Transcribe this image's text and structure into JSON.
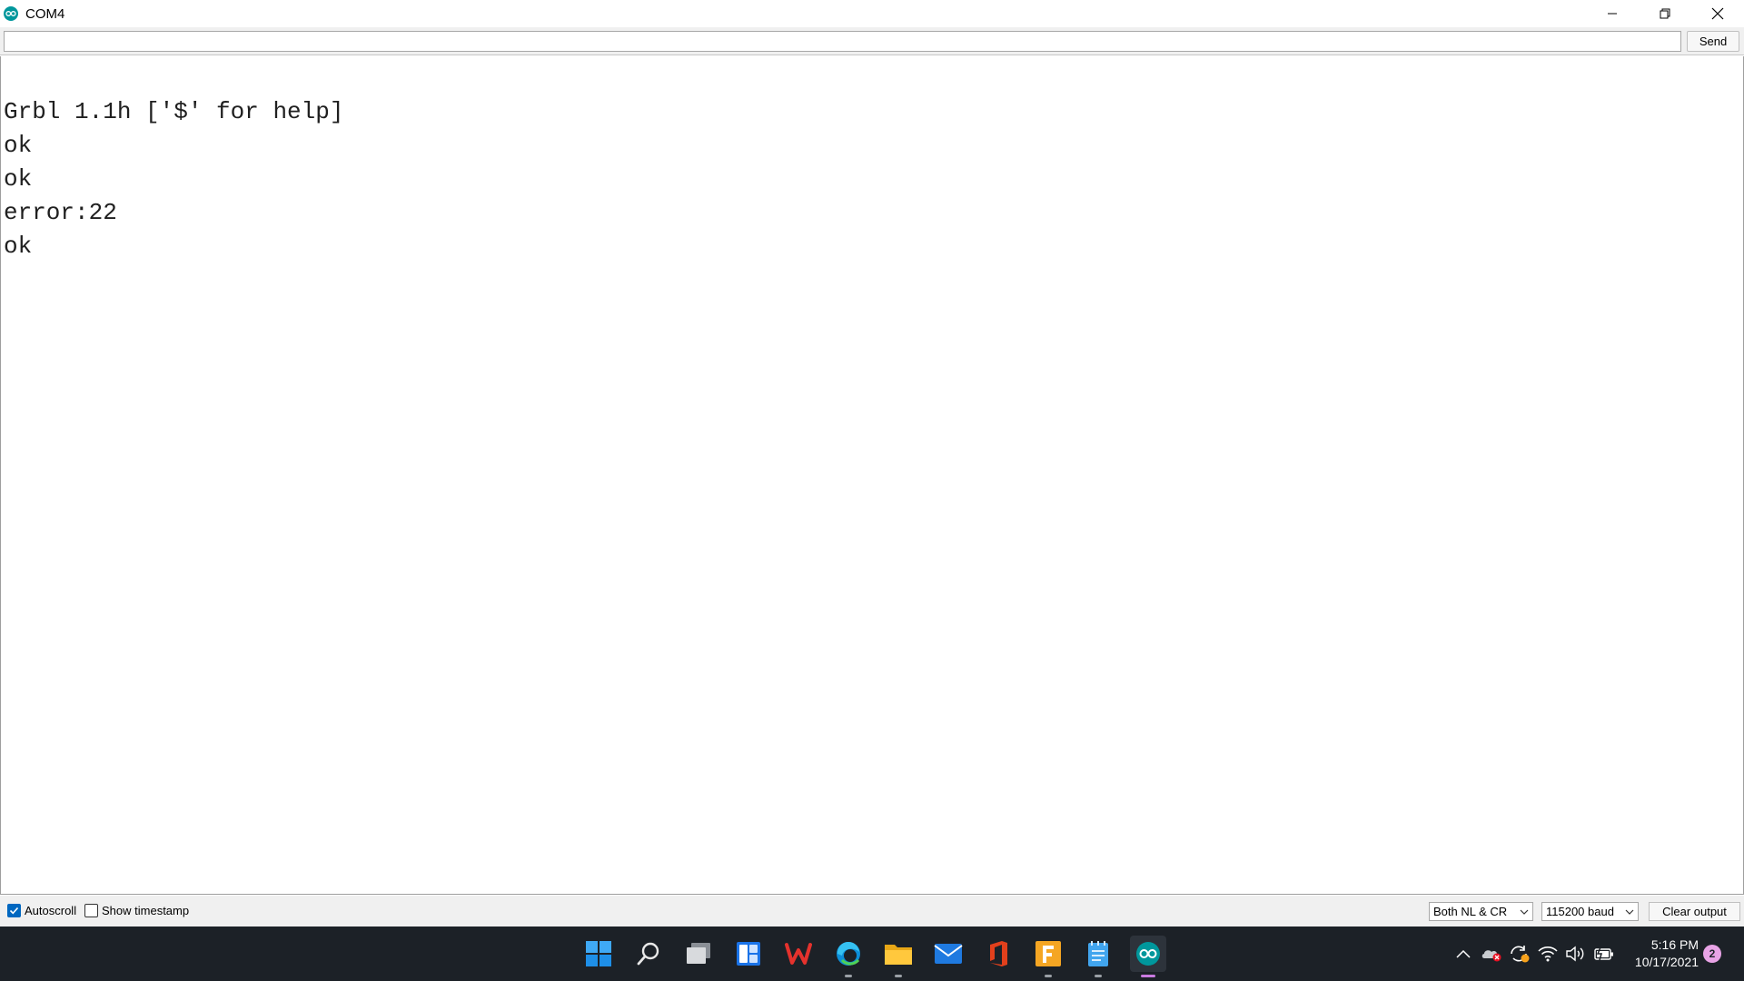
{
  "window": {
    "title": "COM4",
    "icon": "arduino-icon",
    "controls": [
      "minimize-icon",
      "restore-icon",
      "close-icon"
    ]
  },
  "send_bar": {
    "input_value": "",
    "send_label": "Send"
  },
  "output": {
    "lines": [
      "Grbl 1.1h ['$' for help]",
      "ok",
      "ok",
      "error:22",
      "ok"
    ]
  },
  "status_bar": {
    "autoscroll_label": "Autoscroll",
    "autoscroll_checked": true,
    "timestamp_label": "Show timestamp",
    "timestamp_checked": false,
    "line_ending": "Both NL & CR",
    "baud_rate": "115200 baud",
    "clear_label": "Clear output"
  },
  "taskbar": {
    "apps": [
      "start-icon",
      "search-icon",
      "task-view-icon",
      "widgets-icon",
      "wps-office-icon",
      "edge-icon",
      "file-explorer-icon",
      "mail-icon",
      "office-icon",
      "fusion-360-icon",
      "notepad-icon",
      "arduino-icon"
    ],
    "tray": [
      "chevron-up-icon",
      "onedrive-icon",
      "sync-icon",
      "wifi-icon",
      "volume-icon",
      "battery-icon"
    ],
    "time": "5:16 PM",
    "date": "10/17/2021",
    "notification_count": "2"
  },
  "colors": {
    "accent": "#0067c0",
    "arduino": "#00979c",
    "taskbar": "#1c2127"
  }
}
